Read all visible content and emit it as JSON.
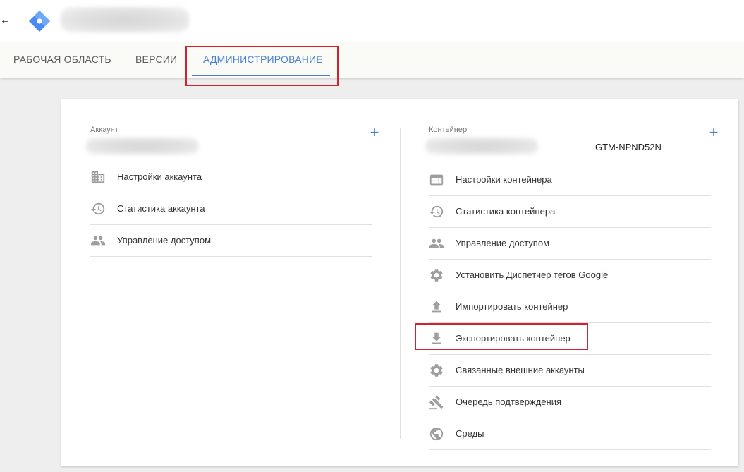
{
  "tabs": [
    {
      "label": "РАБОЧАЯ ОБЛАСТЬ"
    },
    {
      "label": "ВЕРСИИ"
    },
    {
      "label": "АДМИНИСТРИРОВАНИЕ"
    }
  ],
  "account": {
    "section_label": "Аккаунт",
    "items": [
      {
        "icon": "building-icon",
        "label": "Настройки аккаунта"
      },
      {
        "icon": "history-icon",
        "label": "Статистика аккаунта"
      },
      {
        "icon": "people-icon",
        "label": "Управление доступом"
      }
    ]
  },
  "container": {
    "section_label": "Контейнер",
    "id": "GTM-NPND52N",
    "items": [
      {
        "icon": "browser-window-icon",
        "label": "Настройки контейнера"
      },
      {
        "icon": "history-icon",
        "label": "Статистика контейнера"
      },
      {
        "icon": "people-icon",
        "label": "Управление доступом"
      },
      {
        "icon": "gear-icon",
        "label": "Установить Диспетчер тегов Google"
      },
      {
        "icon": "upload-icon",
        "label": "Импортировать контейнер"
      },
      {
        "icon": "download-icon",
        "label": "Экспортировать контейнер"
      },
      {
        "icon": "gear-icon",
        "label": "Связанные внешние аккаунты"
      },
      {
        "icon": "gavel-icon",
        "label": "Очередь подтверждения"
      },
      {
        "icon": "globe-icon",
        "label": "Среды"
      }
    ]
  },
  "colors": {
    "accent": "#4a7fd4",
    "highlight": "#d0232f"
  }
}
